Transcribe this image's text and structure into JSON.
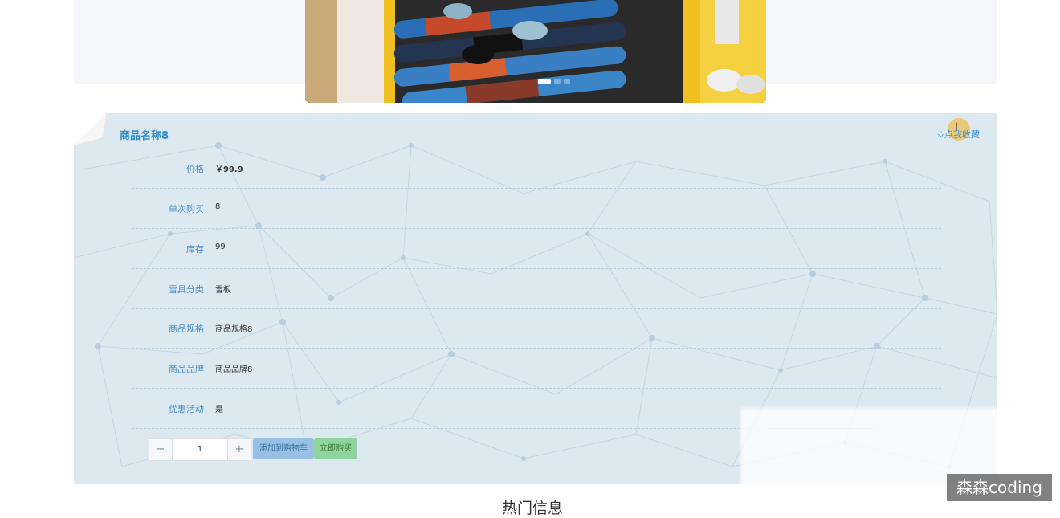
{
  "product": {
    "name": "商品名称8",
    "favorite_label": "✩点我收藏",
    "fields": [
      {
        "label": "价格",
        "value": "￥99.9"
      },
      {
        "label": "单次购买",
        "value": "8"
      },
      {
        "label": "库存",
        "value": "99"
      },
      {
        "label": "雪具分类",
        "value": "雪板"
      },
      {
        "label": "商品规格",
        "value": "商品规格8"
      },
      {
        "label": "商品品牌",
        "value": "商品品牌8"
      },
      {
        "label": "优惠活动",
        "value": "是"
      }
    ]
  },
  "purchase": {
    "minus": "−",
    "quantity": "1",
    "plus": "+",
    "add_to_cart": "添加到购物车",
    "buy_now": "立即购买"
  },
  "section_title": "热门信息",
  "watermark": "森森coding",
  "cursor_glyph": "I",
  "colors": {
    "accent": "#2d8ccc",
    "panel": "#dde9f1",
    "cart": "#98c0e4",
    "buy": "#8fd49a"
  }
}
